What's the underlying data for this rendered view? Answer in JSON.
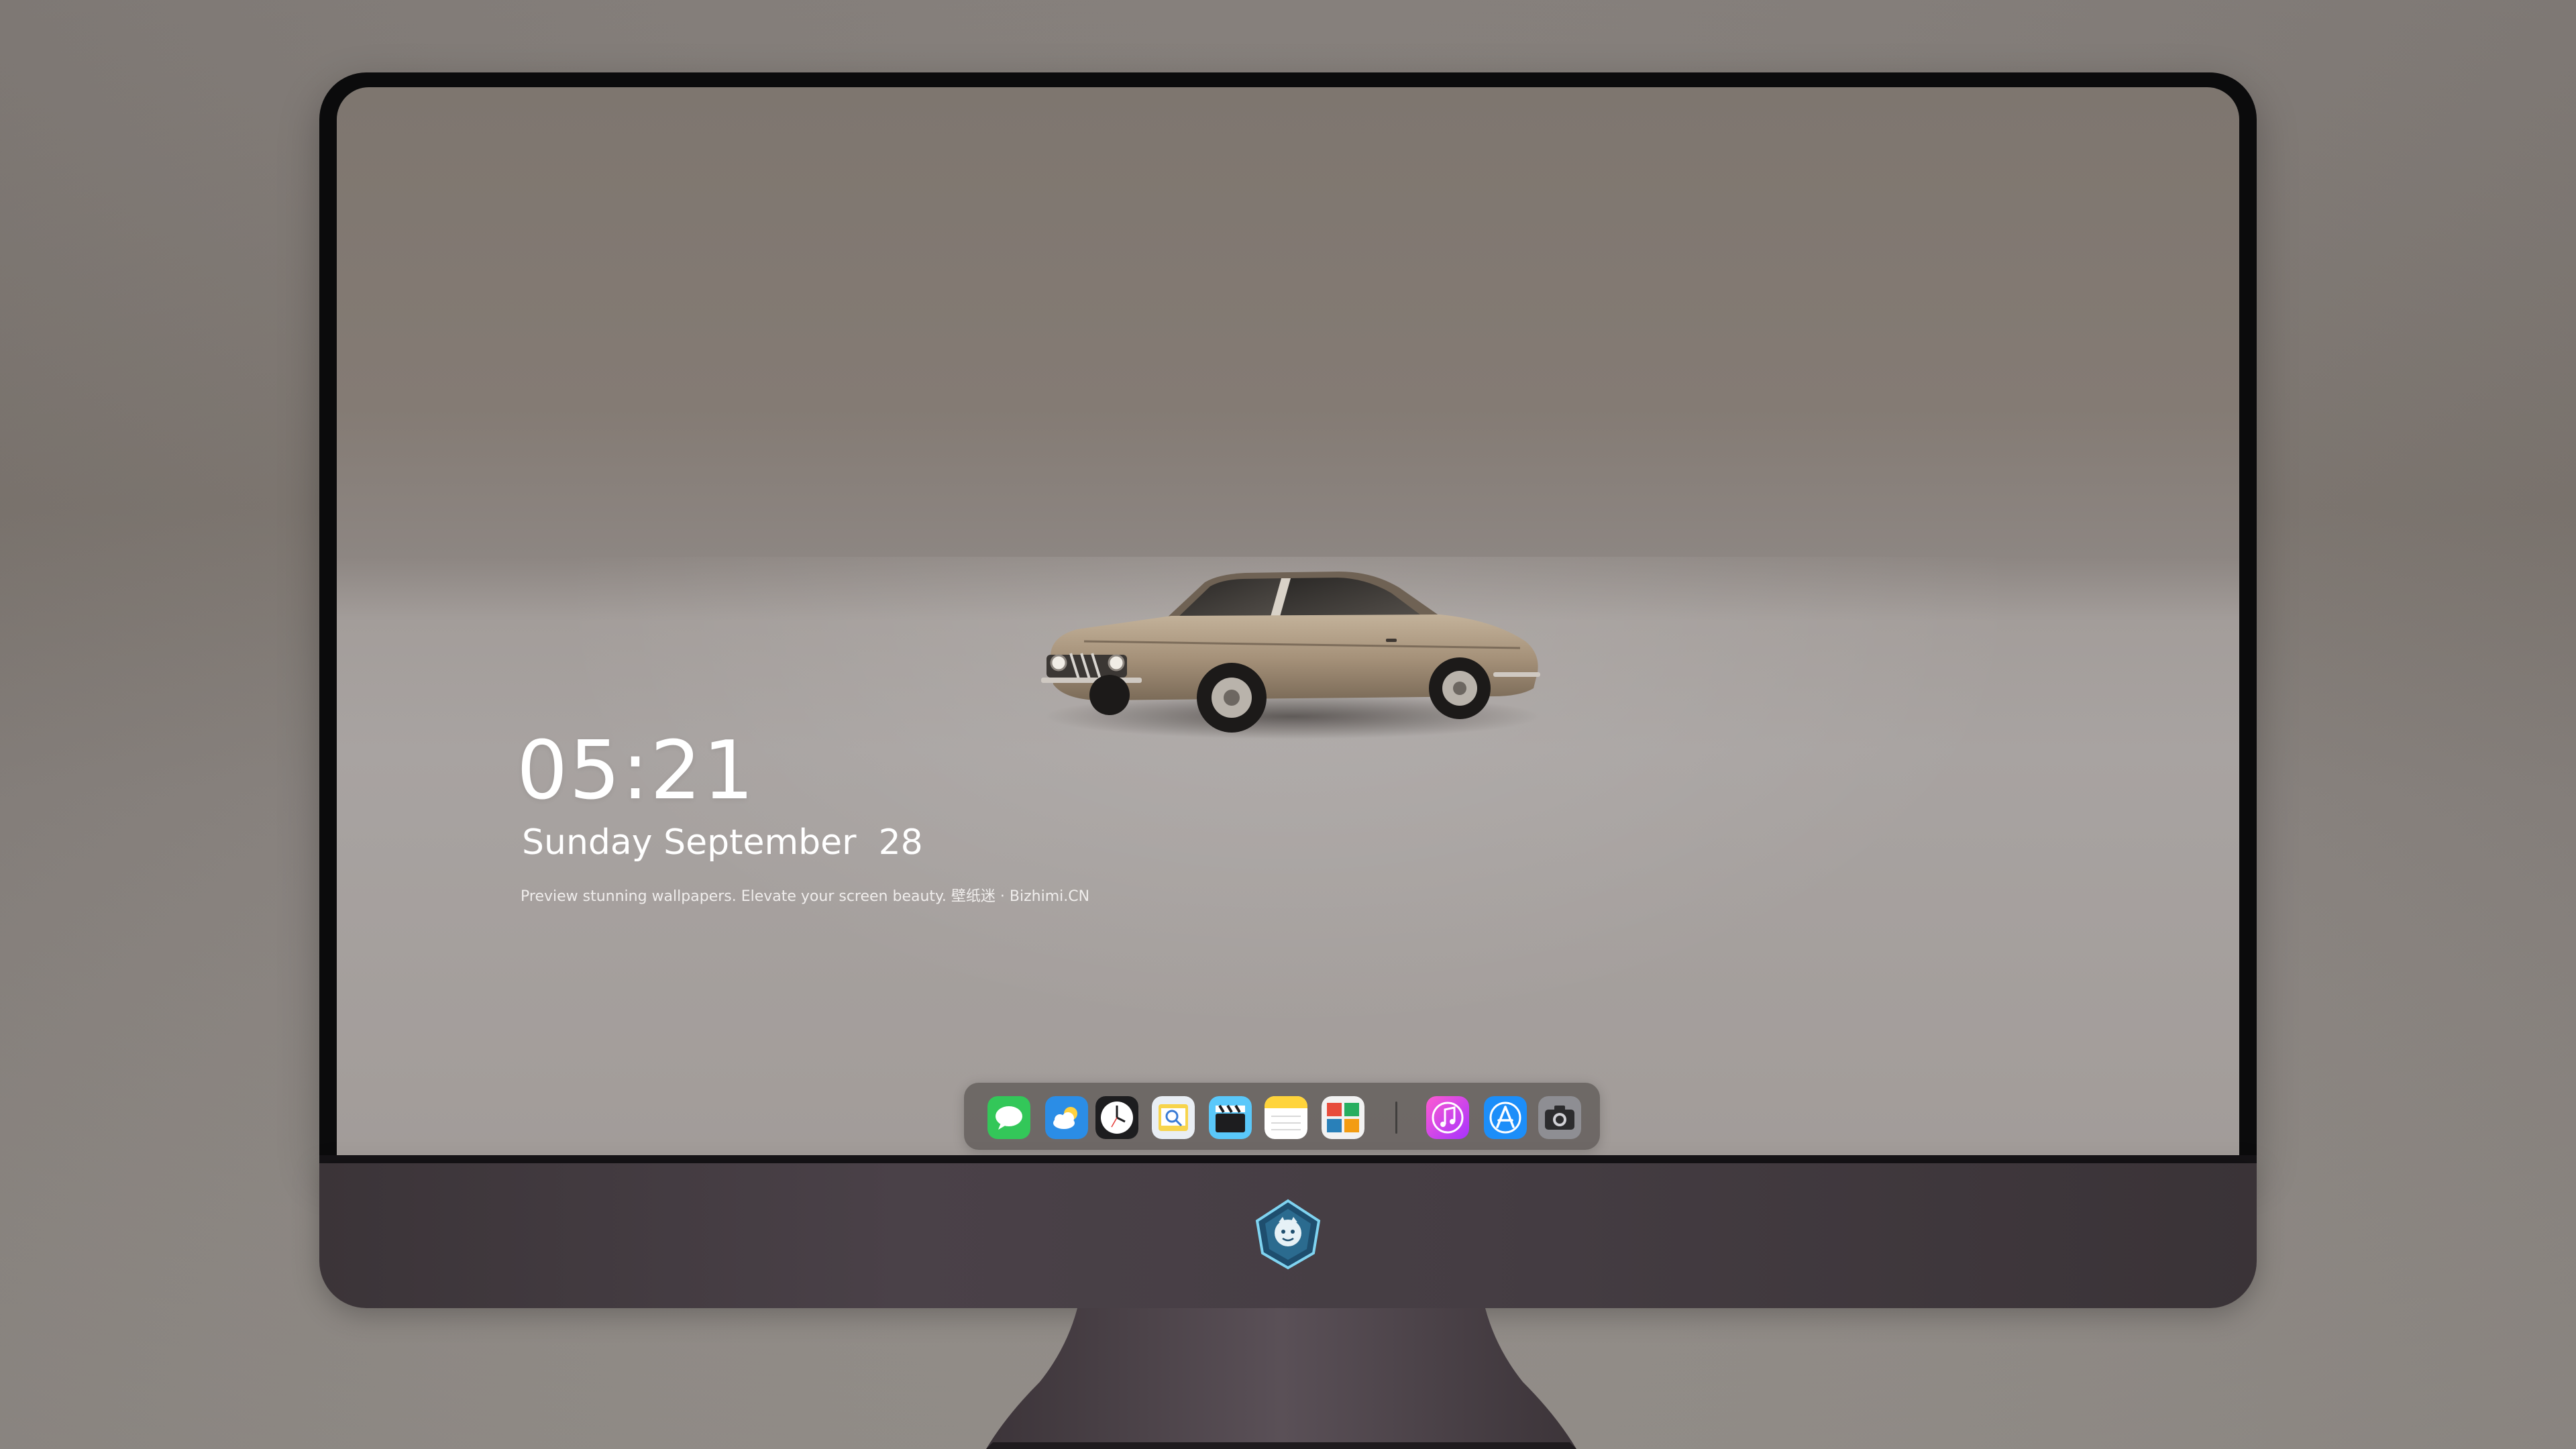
{
  "lock_screen": {
    "time": "05:21",
    "date": "Sunday September  28",
    "caption": "Preview stunning wallpapers. Elevate your screen beauty. 壁纸迷 · Bizhimi.CN"
  },
  "wallpaper": {
    "subject": "vintage-coupe-car",
    "car_color": "#a6927a"
  },
  "dock": {
    "items": [
      {
        "name": "messages",
        "icon": "messages-icon"
      },
      {
        "name": "weather",
        "icon": "weather-icon"
      },
      {
        "name": "clock",
        "icon": "clock-icon"
      },
      {
        "name": "preview",
        "icon": "preview-icon"
      },
      {
        "name": "clips",
        "icon": "clapperboard-icon"
      },
      {
        "name": "notes",
        "icon": "notes-icon"
      },
      {
        "name": "photo-booth",
        "icon": "photo-booth-icon"
      },
      {
        "name": "music",
        "icon": "music-icon"
      },
      {
        "name": "app-store",
        "icon": "app-store-icon"
      },
      {
        "name": "camera",
        "icon": "camera-icon"
      }
    ]
  },
  "colors": {
    "background": "#8b8581",
    "bezel": "#0b0b0c",
    "chin": "#453d43",
    "dock": "#5a5452"
  }
}
